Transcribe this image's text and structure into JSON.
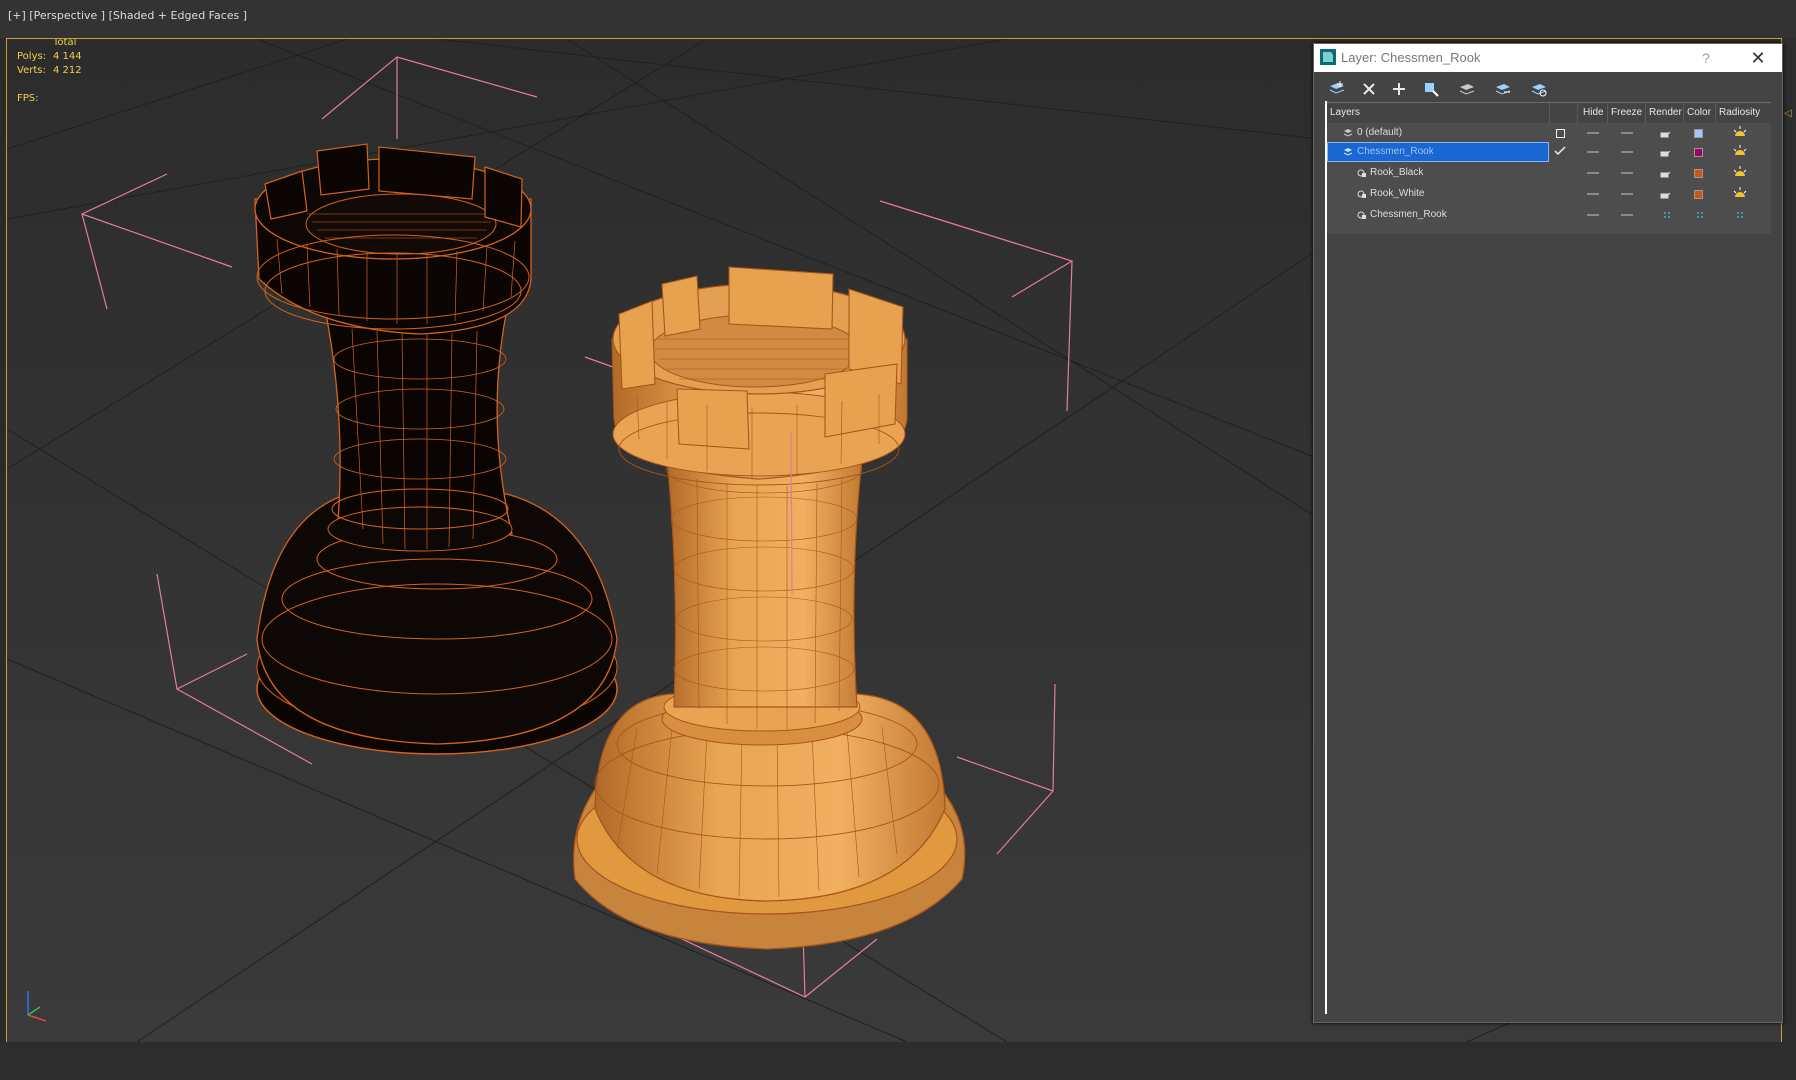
{
  "viewport": {
    "label": "[+] [Perspective ] [Shaded + Edged Faces ]",
    "stats": {
      "total_label": "Total",
      "polys_label": "Polys:",
      "polys_value": "4 144",
      "verts_label": "Verts:",
      "verts_value": "4 212",
      "fps_label": "FPS:"
    },
    "objects": [
      "rook-black",
      "rook-white"
    ],
    "colors": {
      "border": "#c9a233",
      "bbox": "#e87fa8",
      "grid": "#1f1f1f",
      "wire": "#d4631b",
      "rook_white": "#e39b4a",
      "rook_black": "#0d0705"
    }
  },
  "dialog": {
    "title": "Layer: Chessmen_Rook",
    "help": "?",
    "close": "✕",
    "toolbar": [
      "create-layer-icon",
      "delete-layer-icon",
      "add-to-layer-icon",
      "select-objects-icon",
      "highlight-layer-icon",
      "hide-all-icon",
      "freeze-all-icon"
    ],
    "columns": {
      "layers": "Layers",
      "hide": "Hide",
      "freeze": "Freeze",
      "render": "Render",
      "color": "Color",
      "radiosity": "Radiosity"
    },
    "rows": [
      {
        "name": "0 (default)",
        "level": 0,
        "type": "layer",
        "selected": false,
        "active_checkbox": true,
        "color": "#9ecbff"
      },
      {
        "name": "Chessmen_Rook",
        "level": 0,
        "type": "layer",
        "selected": true,
        "current": true,
        "color": "#a1006b"
      },
      {
        "name": "Rook_Black",
        "level": 1,
        "type": "object",
        "selected": false,
        "color": "#c8561a"
      },
      {
        "name": "Rook_White",
        "level": 1,
        "type": "object",
        "selected": false,
        "color": "#c8561a"
      },
      {
        "name": "Chessmen_Rook",
        "level": 1,
        "type": "object",
        "selected": false,
        "color": "#3fb4c8"
      }
    ]
  }
}
